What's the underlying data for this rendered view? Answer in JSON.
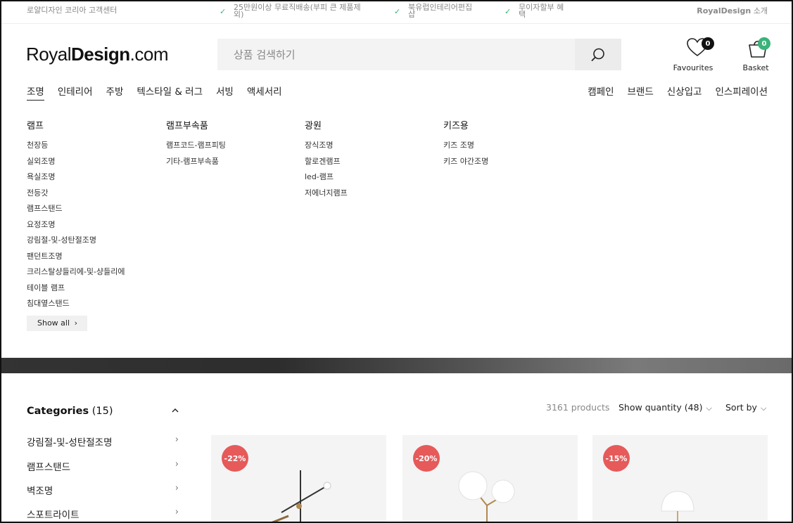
{
  "topbar": {
    "help": "로얄디자인 코리아 고객센터",
    "usps": [
      {
        "line1": "25만원이상 무료직배송(부피 큰 제품제",
        "line2": "외)"
      },
      {
        "line1": "북유럽인테리어편집",
        "line2": "샵"
      },
      {
        "line1": "무이자할부 혜",
        "line2": "택"
      }
    ],
    "about_brand": "RoyalDesign",
    "about_suffix": "소개"
  },
  "header": {
    "logo_light": "Royal",
    "logo_bold": "Design",
    "logo_tail": ".com",
    "search_placeholder": "상품 검색하기",
    "favourites_label": "Favourites",
    "favourites_count": "0",
    "basket_label": "Basket",
    "basket_count": "0"
  },
  "nav": {
    "left": [
      "조명",
      "인테리어",
      "주방",
      "텍스타일 & 러그",
      "서빙",
      "액세서리"
    ],
    "right": [
      "캠페인",
      "브랜드",
      "신상입고",
      "인스피레이션"
    ]
  },
  "mega": {
    "columns": [
      {
        "title": "램프",
        "items": [
          "천장등",
          "실외조명",
          "욕실조명",
          "전등갓",
          "램프스탠드",
          "요정조명",
          "강림절-및-성탄절조명",
          "팬던트조명",
          "크리스탈샹들리에-및-샹들리에",
          "테이블 램프",
          "침대옆스탠드"
        ]
      },
      {
        "title": "램프부속품",
        "items": [
          "램프코드-램프피팅",
          "기타-램프부속품"
        ]
      },
      {
        "title": "광원",
        "items": [
          "장식조명",
          "할로겐램프",
          "led-램프",
          "저에너지램프"
        ]
      },
      {
        "title": "키즈용",
        "items": [
          "키즈 조명",
          "키즈 야간조명"
        ]
      }
    ],
    "show_all": "Show all"
  },
  "sidebar": {
    "title": "Categories",
    "count": "(15)",
    "items": [
      "강림절-및-성탄절조명",
      "램프스탠드",
      "벽조명",
      "스포트라이트"
    ]
  },
  "toolbar": {
    "products": "3161 products",
    "show_quantity": "Show quantity (48)",
    "sort_by": "Sort by"
  },
  "products": [
    {
      "discount": "-22%"
    },
    {
      "discount": "-20%"
    },
    {
      "discount": "-15%"
    }
  ],
  "colors": {
    "discount": "#e65a5a",
    "badge_fav": "#111111",
    "badge_basket": "#3bb37a",
    "check": "#3bb37a"
  }
}
